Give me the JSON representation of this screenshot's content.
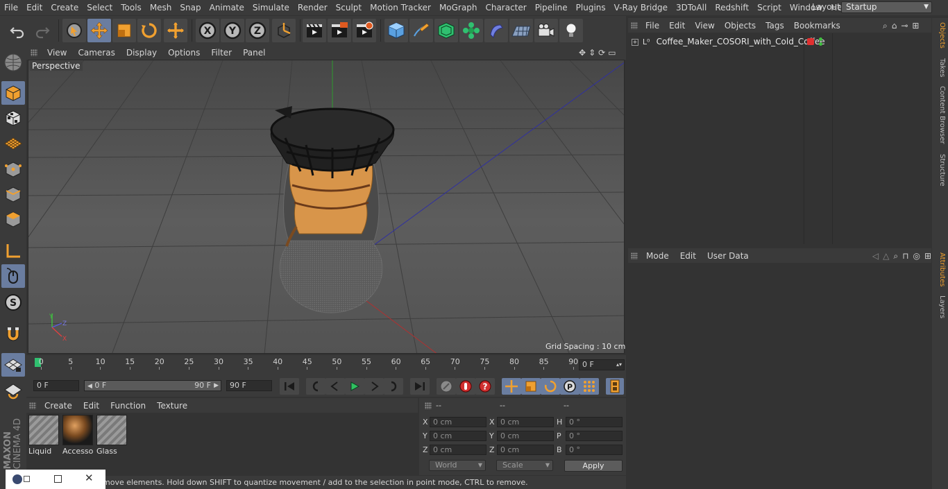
{
  "menubar": {
    "items": [
      "File",
      "Edit",
      "Create",
      "Select",
      "Tools",
      "Mesh",
      "Snap",
      "Animate",
      "Simulate",
      "Render",
      "Sculpt",
      "Motion Tracker",
      "MoGraph",
      "Character",
      "Pipeline",
      "Plugins",
      "V-Ray Bridge",
      "3DToAll",
      "Redshift",
      "Script",
      "Window",
      "Help"
    ],
    "layout_label": "Layout:",
    "layout_value": "Startup"
  },
  "toolbar": {
    "axis_x": "X",
    "axis_y": "Y",
    "axis_z": "Z"
  },
  "viewport": {
    "menu": [
      "View",
      "Cameras",
      "Display",
      "Options",
      "Filter",
      "Panel"
    ],
    "label": "Perspective",
    "grid_spacing": "Grid Spacing : 10 cm"
  },
  "timeline": {
    "ticks": [
      "0",
      "5",
      "10",
      "15",
      "20",
      "25",
      "30",
      "35",
      "40",
      "45",
      "50",
      "55",
      "60",
      "65",
      "70",
      "75",
      "80",
      "85",
      "90"
    ],
    "current_frame": "0 F"
  },
  "transport": {
    "start_field": "0 F",
    "range_start": "0 F",
    "range_end": "90 F",
    "end_field": "90 F"
  },
  "materials": {
    "menu": [
      "Create",
      "Edit",
      "Function",
      "Texture"
    ],
    "items": [
      {
        "label": "Liquid"
      },
      {
        "label": "Accesso"
      },
      {
        "label": "Glass"
      }
    ]
  },
  "coordinates": {
    "headers": [
      "--",
      "--",
      "--"
    ],
    "rows": [
      {
        "a": "X",
        "av": "0 cm",
        "b": "X",
        "bv": "0 cm",
        "c": "H",
        "cv": "0 °"
      },
      {
        "a": "Y",
        "av": "0 cm",
        "b": "Y",
        "bv": "0 cm",
        "c": "P",
        "cv": "0 °"
      },
      {
        "a": "Z",
        "av": "0 cm",
        "b": "Z",
        "bv": "0 cm",
        "c": "B",
        "cv": "0 °"
      }
    ],
    "mode_dropdown": "World",
    "type_dropdown": "Scale",
    "apply": "Apply"
  },
  "status": {
    "text": "move elements. Hold down SHIFT to quantize movement / add to the selection in point mode, CTRL to remove."
  },
  "objects": {
    "menu": [
      "File",
      "Edit",
      "View",
      "Objects",
      "Tags",
      "Bookmarks"
    ],
    "row_name": "Coffee_Maker_COSORI_with_Cold_Coffee"
  },
  "attributes": {
    "menu": [
      "Mode",
      "Edit",
      "User Data"
    ]
  },
  "right_tabs": {
    "top": [
      "Objects",
      "Takes",
      "Content Browser",
      "Structure"
    ],
    "bottom": [
      "Attributes",
      "Layers"
    ]
  },
  "brand": {
    "maxon": "MAXON",
    "product": "CINEMA 4D"
  },
  "colors": {
    "accent": "#6a7da0",
    "orange": "#f0a030",
    "object_red": "#e03030",
    "object_green": "#40c040"
  }
}
